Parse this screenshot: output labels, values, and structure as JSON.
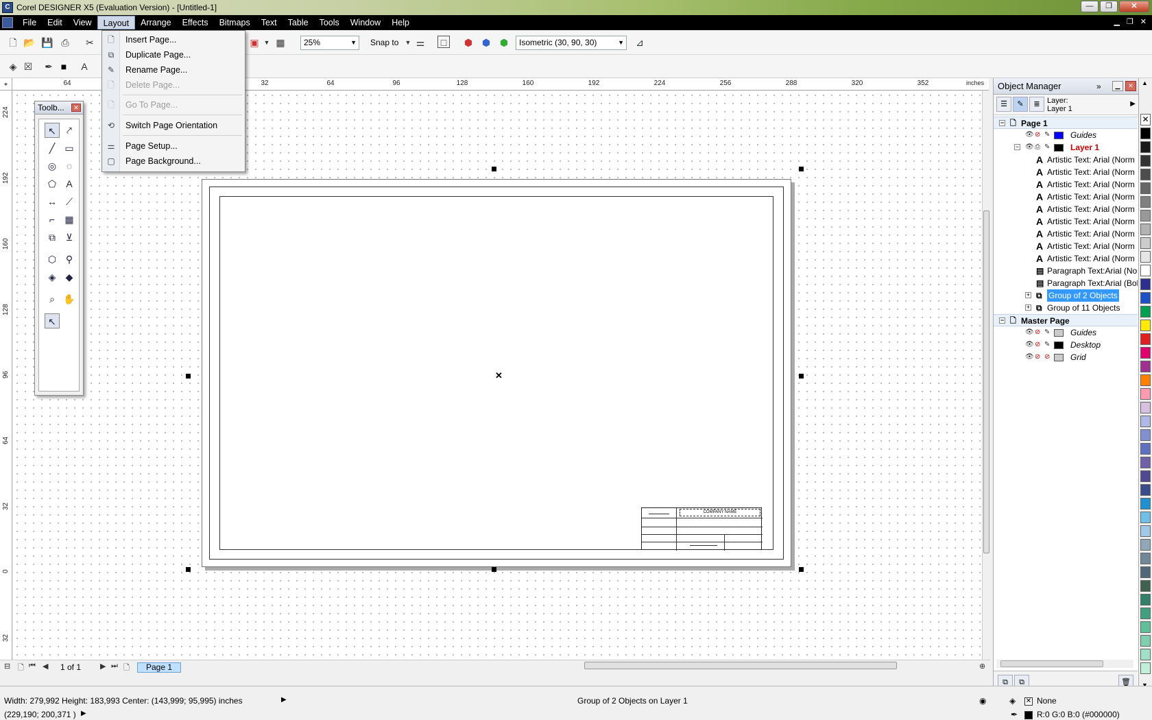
{
  "window": {
    "title": "Corel DESIGNER X5 (Evaluation Version) - [Untitled-1]",
    "buttons": [
      "—",
      "❐",
      "✕"
    ]
  },
  "menubar": {
    "items": [
      "File",
      "Edit",
      "View",
      "Layout",
      "Arrange",
      "Effects",
      "Bitmaps",
      "Text",
      "Table",
      "Tools",
      "Window",
      "Help"
    ],
    "active": "Layout"
  },
  "layout_menu": {
    "items": [
      {
        "label": "Insert Page...",
        "enabled": true
      },
      {
        "label": "Duplicate Page...",
        "enabled": true
      },
      {
        "label": "Rename Page...",
        "enabled": true
      },
      {
        "label": "Delete Page...",
        "enabled": false
      },
      {
        "label": "Go To Page...",
        "enabled": false
      },
      {
        "label": "Switch Page Orientation",
        "enabled": true
      },
      {
        "label": "Page Setup...",
        "enabled": true
      },
      {
        "label": "Page Background...",
        "enabled": true
      }
    ]
  },
  "toolbar": {
    "zoom_value": "25%",
    "snap_to_label": "Snap to",
    "projection_value": "Isometric (30, 90, 30)"
  },
  "rulers": {
    "units": "inches",
    "h_labels": [
      "64",
      "32",
      "64",
      "96",
      "128",
      "160",
      "192",
      "224",
      "256",
      "288",
      "320",
      "352"
    ],
    "v_labels": [
      "224",
      "192",
      "160",
      "128",
      "96",
      "64",
      "32",
      "0",
      "32"
    ]
  },
  "toolbox": {
    "title": "Toolb..."
  },
  "page_nav": {
    "count": "1 of 1",
    "tab": "Page 1"
  },
  "object_manager": {
    "title": "Object Manager",
    "layer_label": "Layer:",
    "layer_value": "Layer 1",
    "page1": "Page 1",
    "guides": "Guides",
    "layer1": "Layer 1",
    "artistic_items": [
      "Artistic Text: Arial (Norm",
      "Artistic Text: Arial (Norm",
      "Artistic Text: Arial (Norm",
      "Artistic Text: Arial (Norm",
      "Artistic Text: Arial (Norm",
      "Artistic Text: Arial (Norm",
      "Artistic Text: Arial (Norm",
      "Artistic Text: Arial (Norm",
      "Artistic Text: Arial (Norm"
    ],
    "paragraph_items": [
      "Paragraph Text:Arial (No",
      "Paragraph Text:Arial (Bol"
    ],
    "group2": "Group of 2 Objects",
    "group11": "Group of 11 Objects",
    "master_page": "Master Page",
    "master_guides": "Guides",
    "master_desktop": "Desktop",
    "master_grid": "Grid"
  },
  "title_block": {
    "company": "COMPANY NAME"
  },
  "status": {
    "dims": "Width: 279,992  Height: 183,993  Center: (143,999; 95,995)  inches",
    "coords": "(229,190; 200,371 )",
    "selection": "Group of 2 Objects on Layer 1",
    "fill": "None",
    "outline": "R:0 G:0 B:0 (#000000)"
  },
  "palette_colors": [
    "#000000",
    "#1a1a1a",
    "#333333",
    "#4d4d4d",
    "#666666",
    "#808080",
    "#999999",
    "#b3b3b3",
    "#cccccc",
    "#e6e6e6",
    "#ffffff",
    "#2e2e8f",
    "#1d4fc7",
    "#00a050",
    "#ffea00",
    "#e02020",
    "#e0006e",
    "#a03090",
    "#ff7f00",
    "#ff9bb0",
    "#d8c0e0",
    "#b0b8e8",
    "#8090d0",
    "#6070c0",
    "#7060a8",
    "#504890",
    "#3a4c8a",
    "#2090d0",
    "#70c0e8",
    "#a0c8e8",
    "#90a8b8",
    "#708898",
    "#506878",
    "#406050",
    "#30806a",
    "#40a080",
    "#60c098",
    "#80d0b0",
    "#a0e0c8",
    "#c0f0d8"
  ]
}
